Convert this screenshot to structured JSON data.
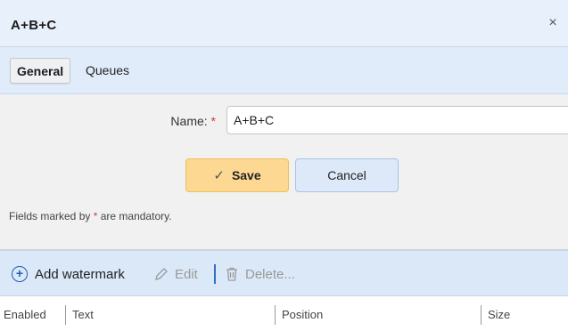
{
  "dialog": {
    "title": "A+B+C",
    "close_icon": "close-icon",
    "close_glyph": "×"
  },
  "tabs": [
    {
      "label": "General",
      "active": true
    },
    {
      "label": "Queues",
      "active": false
    }
  ],
  "form": {
    "name_label": "Name:",
    "required_marker": "*",
    "name_value": "A+B+C",
    "save_label": "Save",
    "save_icon": "check-icon",
    "cancel_label": "Cancel",
    "mandatory_prefix": "Fields marked by",
    "mandatory_marker": "*",
    "mandatory_suffix": "are mandatory."
  },
  "toolbar": {
    "add_label": "Add watermark",
    "add_icon": "plus-circle-icon",
    "edit_label": "Edit",
    "edit_icon": "pencil-icon",
    "delete_label": "Delete...",
    "delete_icon": "trash-icon"
  },
  "grid": {
    "columns": [
      "Enabled",
      "Text",
      "Position",
      "Size"
    ]
  },
  "colors": {
    "accent": "#1f5fb5",
    "save_bg": "#fdd893",
    "required": "#d23b3b"
  }
}
